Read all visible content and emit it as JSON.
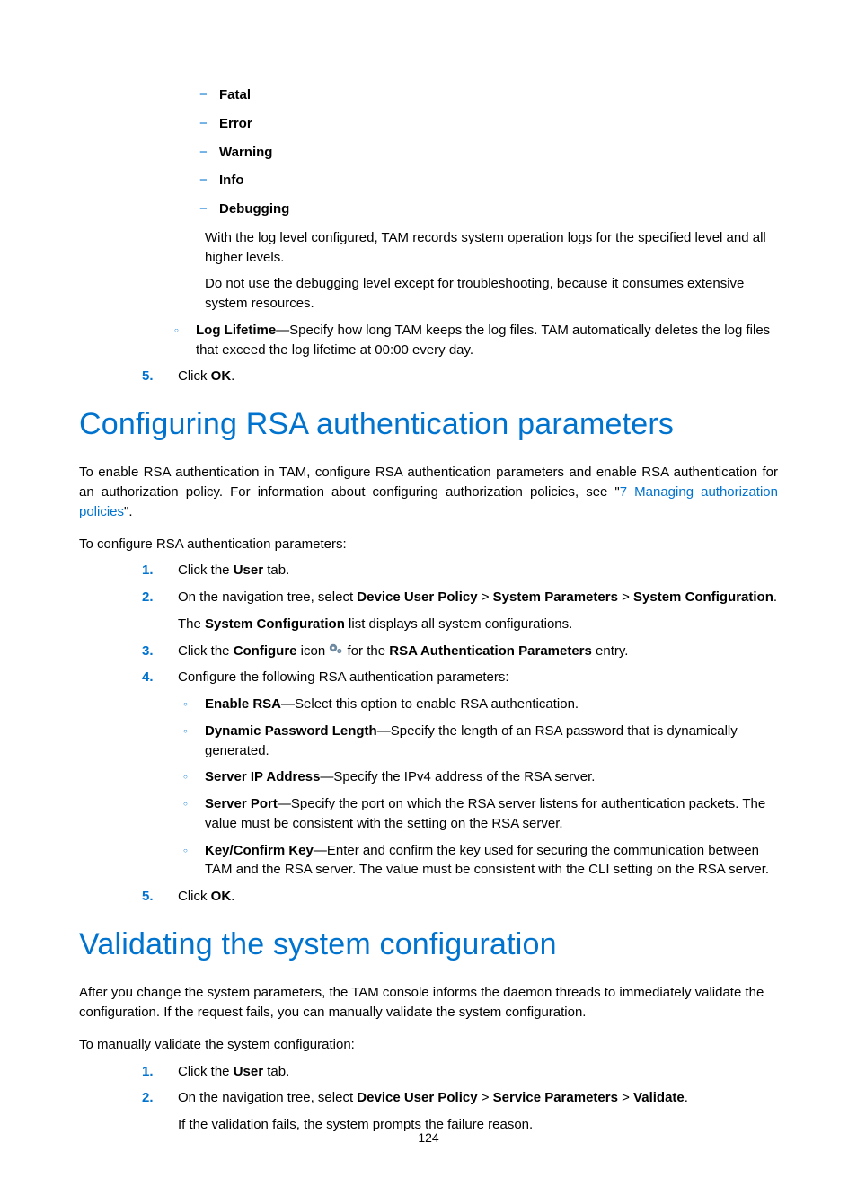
{
  "topDash": [
    "Fatal",
    "Error",
    "Warning",
    "Info",
    "Debugging"
  ],
  "topDashNote1": "With the log level configured, TAM records system operation logs for the specified level and all higher levels.",
  "topDashNote2": "Do not use the debugging level except for troubleshooting, because it consumes extensive system resources.",
  "topCirc": {
    "label": "Log Lifetime",
    "text": "—Specify how long TAM keeps the log files. TAM automatically deletes the log files that exceed the log lifetime at 00:00 every day."
  },
  "step5a": {
    "num": "5.",
    "pre": "Click ",
    "bold": "OK",
    "post": "."
  },
  "h1a": "Configuring RSA authentication parameters",
  "rsaIntroPre": "To enable RSA authentication in TAM, configure RSA authentication parameters and enable RSA authentication for an authorization policy. For information about configuring authorization policies, see \"",
  "rsaIntroLink": "7 Managing authorization policies",
  "rsaIntroPost": "\".",
  "rsaLead": "To configure RSA authentication parameters:",
  "rsaSteps": {
    "s1": {
      "num": "1.",
      "pre": "Click the ",
      "b1": "User",
      "post": " tab."
    },
    "s2": {
      "num": "2.",
      "pre": "On the navigation tree, select ",
      "b1": "Device User Policy",
      "sep1": " > ",
      "b2": "System Parameters",
      "sep2": " > ",
      "b3": "System Configuration",
      "post": ".",
      "line2pre": "The ",
      "line2b": "System Configuration",
      "line2post": " list displays all system configurations."
    },
    "s3": {
      "num": "3.",
      "pre": "Click the ",
      "b1": "Configure",
      "mid": " icon ",
      "mid2": " for the ",
      "b2": "RSA Authentication Parameters",
      "post": " entry."
    },
    "s4": {
      "num": "4.",
      "text": "Configure the following RSA authentication parameters:",
      "items": [
        {
          "label": "Enable RSA",
          "text": "—Select this option to enable RSA authentication."
        },
        {
          "label": "Dynamic Password Length",
          "text": "—Specify the length of an RSA password that is dynamically generated."
        },
        {
          "label": "Server IP Address",
          "text": "—Specify the IPv4 address of the RSA server."
        },
        {
          "label": "Server Port",
          "text": "—Specify the port on which the RSA server listens for authentication packets. The value must be consistent with the setting on the RSA server."
        },
        {
          "label": "Key/Confirm Key",
          "text": "—Enter and confirm the key used for securing the communication between TAM and the RSA server. The value must be consistent with the CLI setting on the RSA server."
        }
      ]
    },
    "s5": {
      "num": "5.",
      "pre": "Click ",
      "bold": "OK",
      "post": "."
    }
  },
  "h1b": "Validating the system configuration",
  "valIntro": "After you change the system parameters, the TAM console informs the daemon threads to immediately validate the configuration. If the request fails, you can manually validate the system configuration.",
  "valLead": "To manually validate the system configuration:",
  "valSteps": {
    "s1": {
      "num": "1.",
      "pre": "Click the ",
      "b1": "User",
      "post": " tab."
    },
    "s2": {
      "num": "2.",
      "pre": "On the navigation tree, select ",
      "b1": "Device User Policy",
      "sep1": " > ",
      "b2": "Service Parameters",
      "sep2": " > ",
      "b3": "Validate",
      "post": ".",
      "line2": "If the validation fails, the system prompts the failure reason."
    }
  },
  "pageNumber": "124"
}
